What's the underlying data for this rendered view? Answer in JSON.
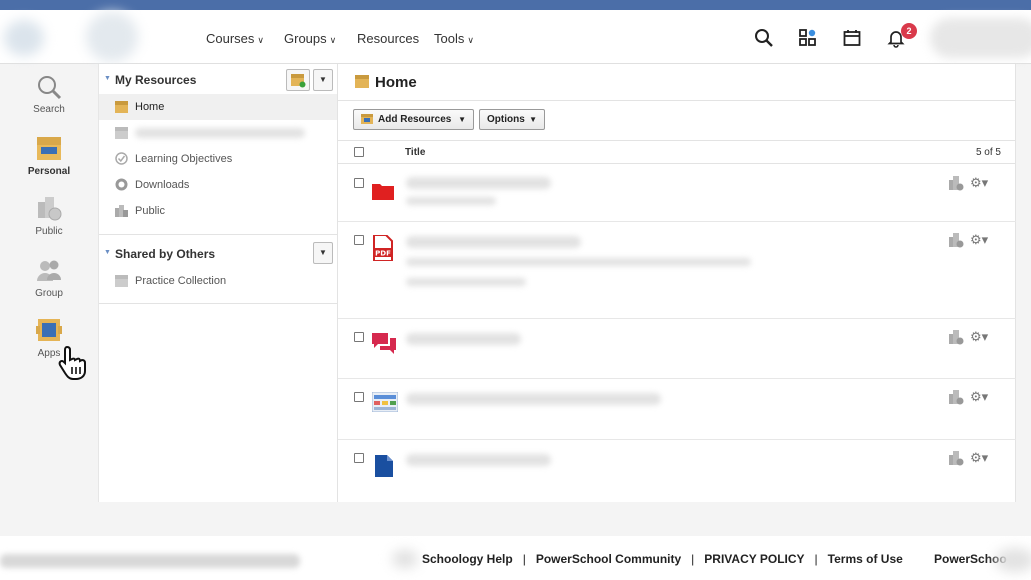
{
  "header": {
    "nav": [
      {
        "label": "Courses",
        "has_menu": true
      },
      {
        "label": "Groups",
        "has_menu": true
      },
      {
        "label": "Resources",
        "has_menu": false
      },
      {
        "label": "Tools",
        "has_menu": true
      }
    ],
    "notifications_count": "2",
    "icons": [
      "search-icon",
      "apps-grid-icon",
      "calendar-icon",
      "bell-icon"
    ]
  },
  "left_rail": {
    "items": [
      {
        "label": "Search",
        "icon": "search-icon"
      },
      {
        "label": "Personal",
        "icon": "personal-resources-icon",
        "active": true
      },
      {
        "label": "Public",
        "icon": "public-icon"
      },
      {
        "label": "Group",
        "icon": "group-icon"
      },
      {
        "label": "Apps",
        "icon": "apps-icon"
      }
    ]
  },
  "my_resources": {
    "title": "My Resources",
    "items": [
      {
        "label": "Home",
        "icon": "collection-icon",
        "selected": true
      },
      {
        "label": "",
        "icon": "collection-icon",
        "blurred": true
      },
      {
        "label": "Learning Objectives",
        "icon": "objectives-icon"
      },
      {
        "label": "Downloads",
        "icon": "downloads-icon"
      },
      {
        "label": "Public",
        "icon": "public-icon"
      }
    ]
  },
  "shared": {
    "title": "Shared by Others",
    "items": [
      {
        "label": "Practice Collection",
        "icon": "collection-icon"
      }
    ]
  },
  "main": {
    "title": "Home",
    "toolbar": {
      "add_resources": "Add Resources",
      "options": "Options"
    },
    "columns": {
      "title": "Title",
      "count": "5 of 5"
    },
    "rows": [
      {
        "type": "folder-icon",
        "color": "#e02020"
      },
      {
        "type": "pdf-icon",
        "color": "#d02424"
      },
      {
        "type": "discussion-icon",
        "color": "#d6294e"
      },
      {
        "type": "image-icon",
        "color": "#5a8ed8"
      },
      {
        "type": "document-icon",
        "color": "#1a4fa0"
      }
    ]
  },
  "footer": {
    "links": [
      "Schoology Help",
      "PowerSchool Community",
      "PRIVACY POLICY",
      "Terms of Use"
    ],
    "separator": "|",
    "brand": "PowerSchoo"
  },
  "colors": {
    "top_stripe": "#4b6ea8",
    "badge": "#d93a4b",
    "accent": "#6a8ec4"
  }
}
